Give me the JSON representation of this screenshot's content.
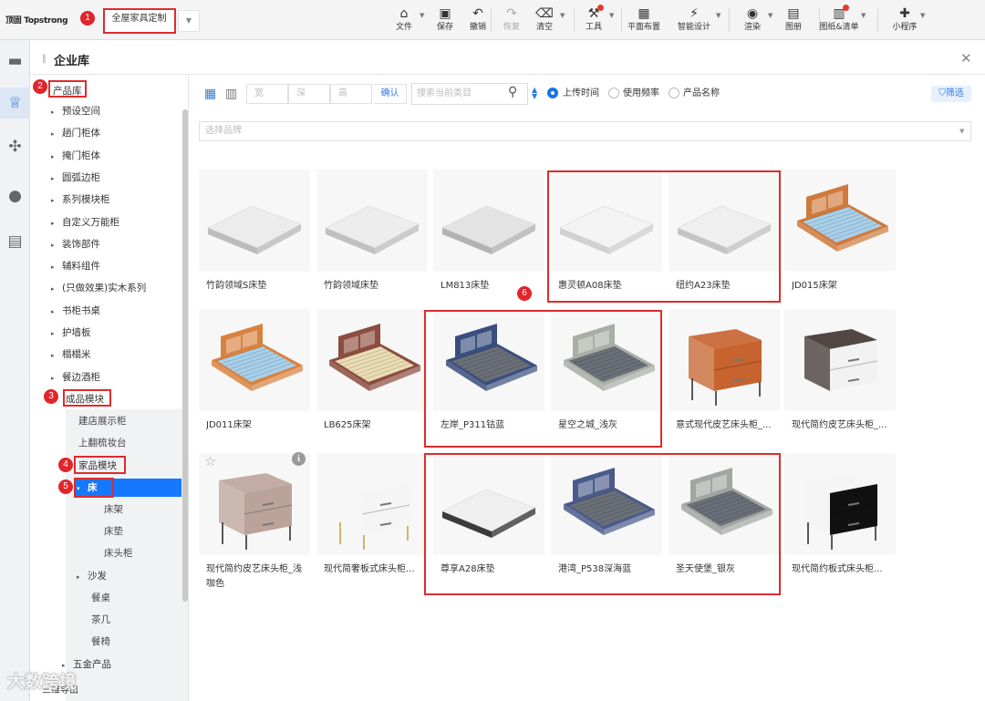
{
  "app": {
    "logo": "顶固 Topstrong",
    "scheme": "全屋家具定制"
  },
  "toolbar": [
    {
      "label": "文件",
      "icon": "file-icon",
      "glyph": "⌂",
      "caret": true
    },
    {
      "label": "保存",
      "icon": "save-icon",
      "glyph": "▣"
    },
    {
      "label": "撤销",
      "icon": "undo-icon",
      "glyph": "↶"
    },
    {
      "label": "恢复",
      "icon": "redo-icon",
      "glyph": "↷",
      "disabled": true
    },
    {
      "label": "清空",
      "icon": "eraser-icon",
      "glyph": "⌫",
      "caret": true
    },
    {
      "label": "工具",
      "icon": "tools-icon",
      "glyph": "⚒",
      "caret": true,
      "dot": true
    },
    {
      "label": "平面布置",
      "icon": "floorplan-icon",
      "glyph": "▦"
    },
    {
      "label": "智能设计",
      "icon": "lightning-icon",
      "glyph": "⚡",
      "caret": true
    },
    {
      "label": "渲染",
      "icon": "camera-icon",
      "glyph": "◉",
      "caret": true
    },
    {
      "label": "图册",
      "icon": "album-icon",
      "glyph": "▤"
    },
    {
      "label": "图纸&清单",
      "icon": "drawing-list-icon",
      "glyph": "▥",
      "caret": true,
      "dot": true
    },
    {
      "label": "小程序",
      "icon": "puzzle-icon",
      "glyph": "✚",
      "caret": true
    }
  ],
  "library": {
    "title": "企业库",
    "tree": {
      "root": "产品库",
      "items": [
        "预设空间",
        "趟门柜体",
        "掩门柜体",
        "圆弧边柜",
        "系列模块柜",
        "自定义万能柜",
        "装饰部件",
        "辅料组件",
        "(只做效果)实木系列",
        "书柜书桌",
        "护墙板",
        "榻榻米",
        "餐边酒柜"
      ],
      "finished": "成品模块",
      "finished_children": [
        "建店展示柜",
        "上翻梳妆台"
      ],
      "home": "家品模块",
      "bed": "床",
      "bed_children": [
        "床架",
        "床垫",
        "床头柜"
      ],
      "home_children": [
        "沙发",
        "餐桌",
        "茶几",
        "餐椅"
      ],
      "hardware": "五金产品",
      "bottom_item": "三维导出"
    }
  },
  "filters": {
    "width_placeholder": "宽",
    "depth_placeholder": "深",
    "height_placeholder": "高",
    "confirm": "确认",
    "search_placeholder": "搜索当前类目",
    "sort_options": [
      "上传时间",
      "使用频率",
      "产品名称"
    ],
    "sort_selected": "上传时间",
    "filter_button": "筛选",
    "brand_placeholder": "选择品牌"
  },
  "products": [
    {
      "name": "竹韵领域S床垫",
      "kind": "mattress",
      "color": "#ececec",
      "edge": "#bcbcbc"
    },
    {
      "name": "竹韵领域床垫",
      "kind": "mattress",
      "color": "#ededed",
      "edge": "#c0c0c0"
    },
    {
      "name": "LM813床垫",
      "kind": "mattress",
      "color": "#e3e3e3",
      "edge": "#b3b3b3"
    },
    {
      "name": "惠灵顿A08床垫",
      "kind": "mattress",
      "color": "#f3f3f3",
      "edge": "#d1d1d1"
    },
    {
      "name": "纽约A23床垫",
      "kind": "mattress",
      "color": "#efefef",
      "edge": "#c4c4c4"
    },
    {
      "name": "JD015床架",
      "kind": "bed",
      "color": "#cf7a3c",
      "slat": "#a8d0ea"
    },
    {
      "name": "JD011床架",
      "kind": "bed",
      "color": "#d9823f",
      "slat": "#a8d0ea"
    },
    {
      "name": "LB625床架",
      "kind": "bed",
      "color": "#8c4c3e",
      "slat": "#eadcb4"
    },
    {
      "name": "左岸_P311钴蓝",
      "kind": "bed",
      "color": "#3a4e7d",
      "slat": "#6a6f78"
    },
    {
      "name": "星空之城_浅灰",
      "kind": "bed",
      "color": "#a9aea6",
      "slat": "#6a6f78"
    },
    {
      "name": "意式现代皮艺床头柜_...",
      "kind": "nightstand",
      "color": "#c7632e",
      "front": "#c7632e",
      "legs": true
    },
    {
      "name": "现代简约皮艺床头柜_...",
      "kind": "nightstand",
      "color": "#3e3330",
      "front": "#f2f2f2"
    },
    {
      "name": "现代简约皮艺床头柜_浅咖色",
      "kind": "nightstand",
      "color": "#bba39a",
      "front": "#bba39a",
      "legs": true
    },
    {
      "name": "现代简奢板式床头柜...",
      "kind": "nightstand",
      "color": "#f5f5f5",
      "front": "#f5f5f5",
      "legs": true,
      "goldlegs": true
    },
    {
      "name": "尊享A28床垫",
      "kind": "mattress",
      "color": "#efefef",
      "edge": "#3b3b3b"
    },
    {
      "name": "港湾_P538深海蓝",
      "kind": "bed",
      "color": "#4a5b8a",
      "slat": "#6a6f78"
    },
    {
      "name": "圣天使堡_银灰",
      "kind": "bed",
      "color": "#a2a6a2",
      "slat": "#6a6f78"
    },
    {
      "name": "现代简约板式床头柜...",
      "kind": "nightstand",
      "color": "#f4f4f4",
      "front": "#111111",
      "legs": true
    }
  ],
  "annotations": [
    "1",
    "2",
    "3",
    "4",
    "5",
    "6"
  ],
  "watermark": "大数跨境"
}
